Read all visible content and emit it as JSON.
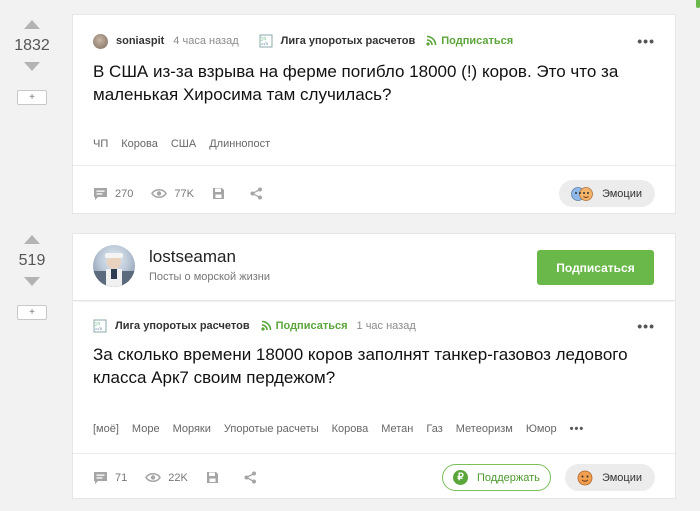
{
  "post1": {
    "rating": "1832",
    "plus": "+",
    "author": "soniaspit",
    "time": "4 часа назад",
    "community": "Лига упоротых расчетов",
    "subscribe": "Подписаться",
    "title": "В США из-за взрыва на ферме погибло 18000 (!) коров. Это что за маленькая Хиросима там случилась?",
    "tags": [
      "ЧП",
      "Корова",
      "США",
      "Длиннопост"
    ],
    "comments": "270",
    "views": "77K",
    "emotions": "Эмоции"
  },
  "post2": {
    "rating": "519",
    "plus": "+",
    "author_name": "lostseaman",
    "author_desc": "Посты о морской жизни",
    "subscribe_button": "Подписаться",
    "community": "Лига упоротых расчетов",
    "subscribe": "Подписаться",
    "time": "1 час назад",
    "title": "За сколько времени 18000 коров заполнят танкер-газовоз ледового класса Арк7 своим пердежом?",
    "tags": [
      "[моё]",
      "Море",
      "Моряки",
      "Упоротые расчеты",
      "Корова",
      "Метан",
      "Газ",
      "Метеоризм",
      "Юмор"
    ],
    "more_tags": "•••",
    "comments": "71",
    "views": "22K",
    "support": "Поддержать",
    "emotions": "Эмоции"
  },
  "more_menu": "•••",
  "colors": {
    "accent": "#69b849",
    "link_green": "#5ba53b"
  },
  "icons": [
    "comment-icon",
    "eye-icon",
    "save-icon",
    "share-icon",
    "emotion-icon",
    "ruble-icon",
    "subscribe-icon"
  ]
}
